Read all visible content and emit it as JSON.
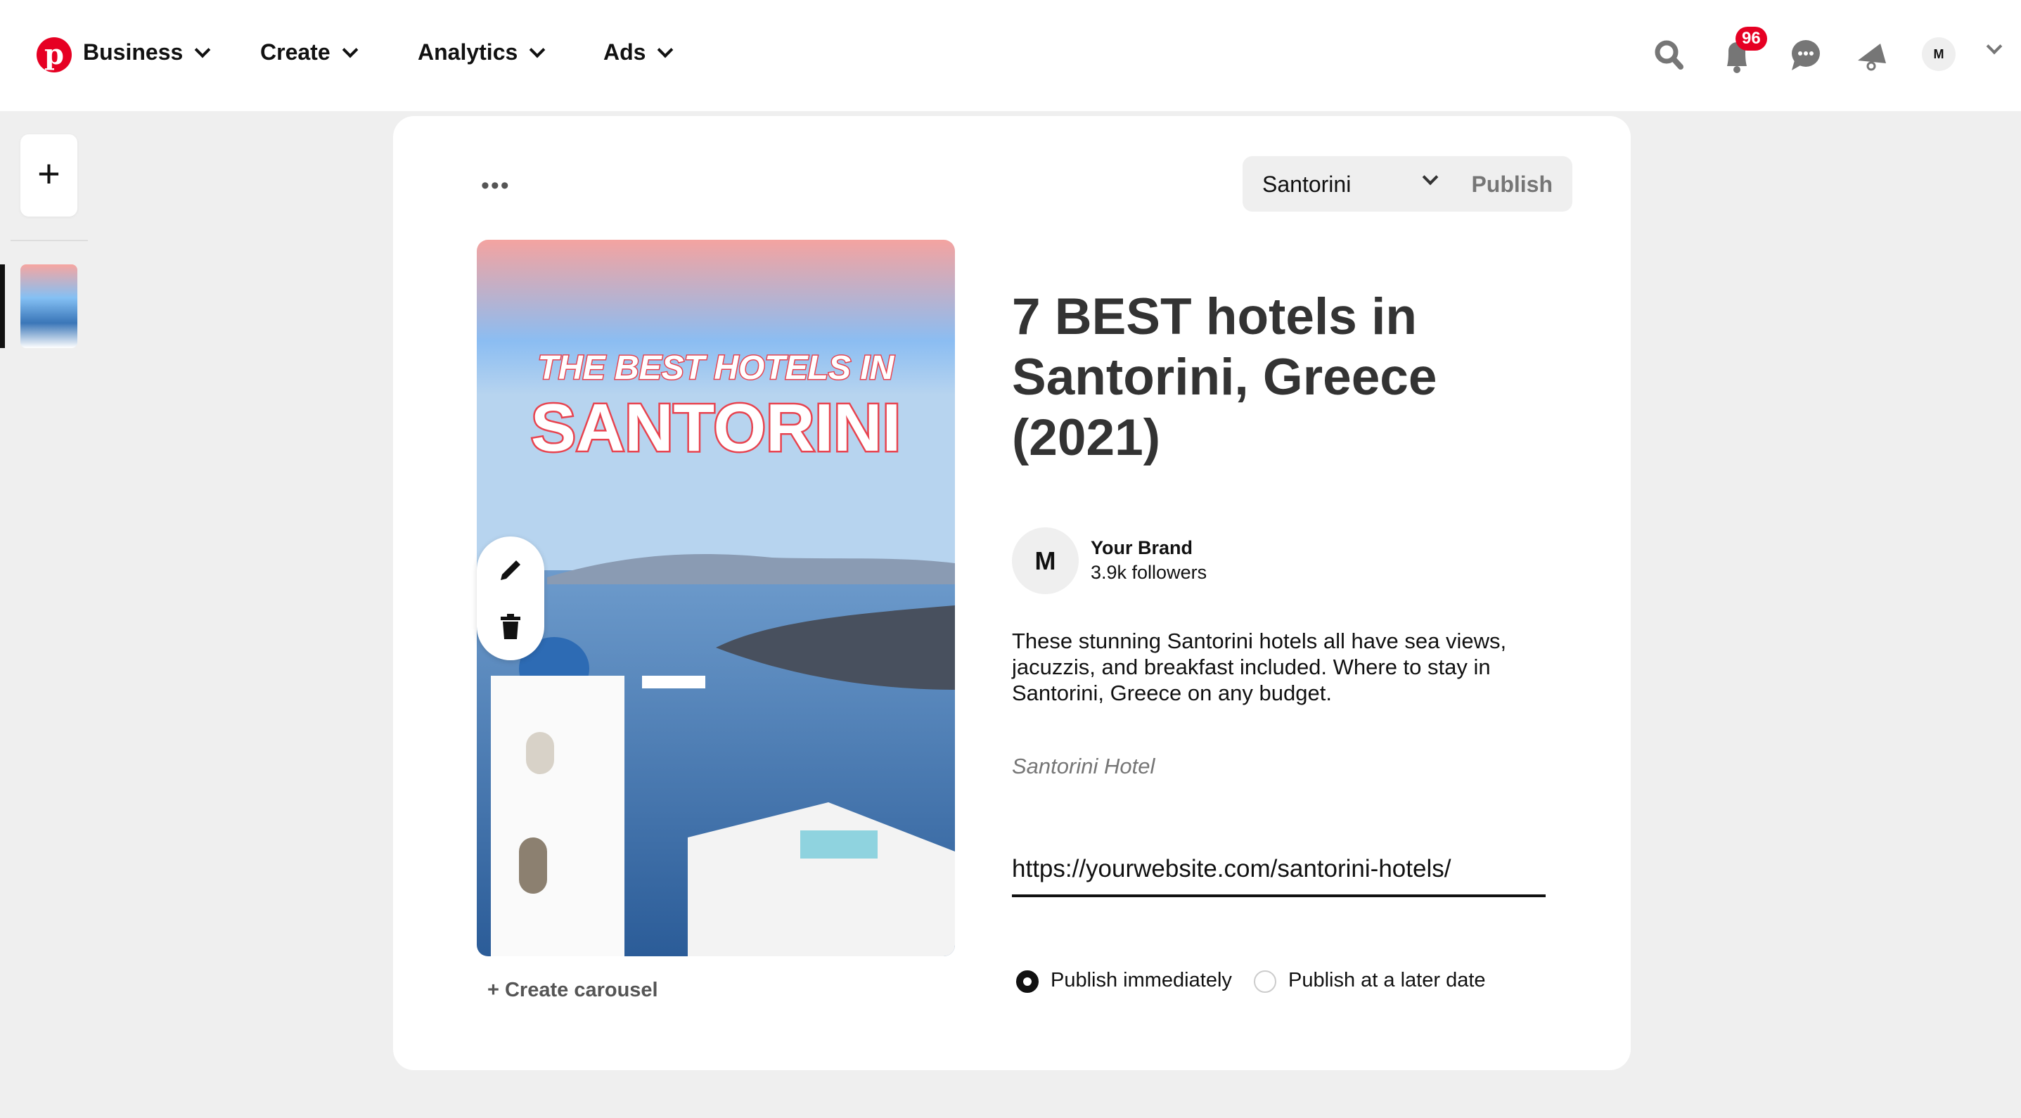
{
  "header": {
    "brand": "Business",
    "nav": [
      "Create",
      "Analytics",
      "Ads"
    ],
    "notifications_count": "96",
    "avatar_initial": "M",
    "colors": {
      "brand": "#e60023"
    }
  },
  "sidebar": {
    "add_label": "+"
  },
  "editor": {
    "more_label": "•••",
    "board": "Santorini",
    "publish_label": "Publish",
    "image": {
      "headline_top": "THE BEST HOTELS IN",
      "headline_main": "SANTORINI"
    },
    "title": "7 BEST hotels in Santorini, Greece (2021)",
    "brand": {
      "initial": "M",
      "name": "Your Brand",
      "followers": "3.9k followers"
    },
    "description": "These stunning Santorini hotels all have sea views, jacuzzis, and breakfast included. Where to stay in Santorini, Greece on any budget.",
    "alt_text": "Santorini Hotel",
    "link": "https://yourwebsite.com/santorini-hotels/",
    "publish_options": [
      {
        "label": "Publish immediately",
        "selected": true
      },
      {
        "label": "Publish at a later date",
        "selected": false
      }
    ],
    "create_carousel": "+ Create carousel"
  }
}
